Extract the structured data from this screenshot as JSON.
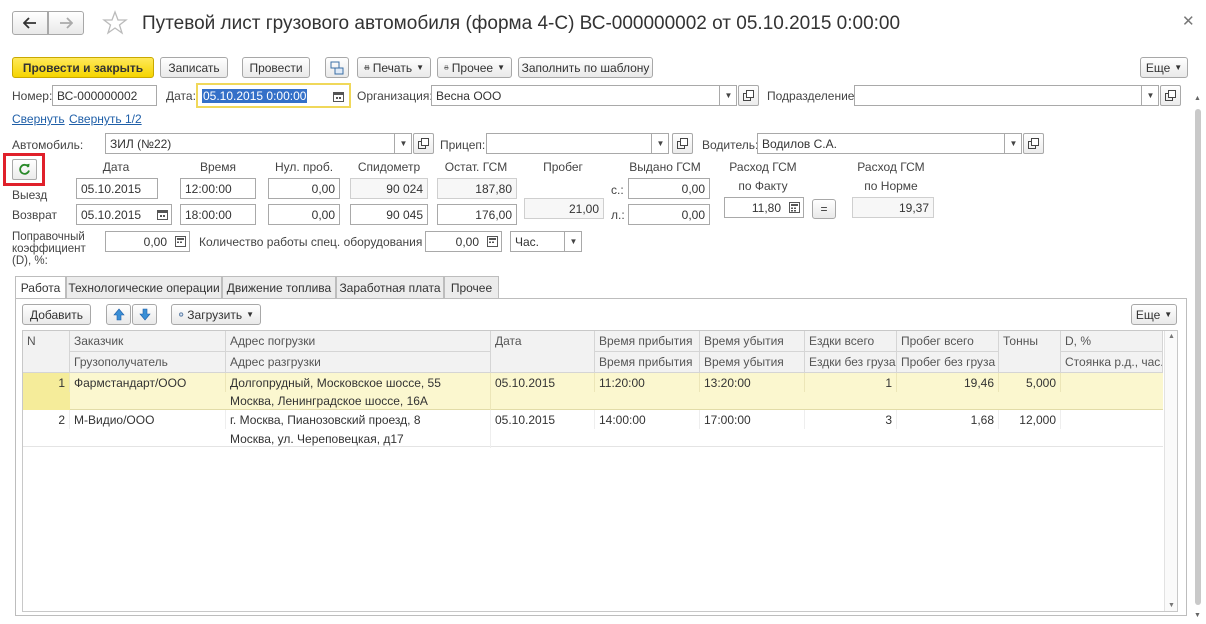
{
  "window": {
    "title": "Путевой лист грузового автомобиля (форма 4-С) ВС-000000002 от 05.10.2015 0:00:00"
  },
  "toolbar": {
    "post_close": "Провести и закрыть",
    "save": "Записать",
    "post": "Провести",
    "print": "Печать",
    "other": "Прочее",
    "fill_template": "Заполнить по шаблону",
    "more": "Еще"
  },
  "header": {
    "number_label": "Номер:",
    "number_value": "ВС-000000002",
    "date_label": "Дата:",
    "date_value": "05.10.2015  0:00:00",
    "org_label": "Организация:",
    "org_value": "Весна ООО",
    "dept_label": "Подразделение:",
    "dept_value": "",
    "collapse": "Свернуть",
    "collapse_half": "Свернуть 1/2"
  },
  "vehicle": {
    "car_label": "Автомобиль:",
    "car_value": "ЗИЛ (№22)",
    "trailer_label": "Прицеп:",
    "trailer_value": "",
    "driver_label": "Водитель:",
    "driver_value": "Водилов С.А."
  },
  "trip": {
    "col_date": "Дата",
    "col_time": "Время",
    "col_zero": "Нул. проб.",
    "col_odo": "Спидометр",
    "col_fuel": "Остат. ГСМ",
    "col_mileage": "Пробег",
    "col_issued": "Выдано ГСМ",
    "col_fact": "Расход ГСМ",
    "col_fact2": "по Факту",
    "col_norm": "Расход ГСМ",
    "col_norm2": "по Норме",
    "departure_label": "Выезд",
    "return_label": "Возврат",
    "dep_date": "05.10.2015",
    "dep_time": "12:00:00",
    "dep_zero": "0,00",
    "dep_odo": "90 024",
    "dep_fuel": "187,80",
    "ret_date": "05.10.2015",
    "ret_time": "18:00:00",
    "ret_zero": "0,00",
    "ret_odo": "90 045",
    "ret_fuel": "176,00",
    "mileage": "21,00",
    "issued_c_label": "с.:",
    "issued_c": "0,00",
    "issued_l_label": "л.:",
    "issued_l": "0,00",
    "fact": "11,80",
    "eq": "=",
    "norm": "19,37",
    "coef_label": "Поправочный коэффициент (D), %:",
    "coef_value": "0,00",
    "equip_label": "Количество работы спец. оборудования (Т):",
    "equip_value": "0,00",
    "unit_value": "Час."
  },
  "tabs": [
    "Работа",
    "Технологические операции",
    "Движение топлива",
    "Заработная плата",
    "Прочее"
  ],
  "table_toolbar": {
    "add": "Добавить",
    "load": "Загрузить",
    "more": "Еще"
  },
  "table": {
    "headers_top": [
      "N",
      "Заказчик",
      "Адрес погрузки",
      "Дата",
      "Время прибытия",
      "Время убытия",
      "Ездки всего",
      "Пробег всего",
      "Тонны",
      "D, %"
    ],
    "headers_bottom": [
      "",
      "Грузополучатель",
      "Адрес разгрузки",
      "",
      "Время прибытия",
      "Время убытия",
      "Ездки без груза",
      "Пробег без груза",
      "",
      "Стоянка р.д., час."
    ],
    "rows": [
      {
        "n": "1",
        "customer": "Фармстандарт/ООО",
        "load_addr": "Долгопрудный, Московское шоссе, 55",
        "unload_addr": "Москва, Ленинградское шоссе, 16А",
        "date": "05.10.2015",
        "arrive": "11:20:00",
        "depart": "13:20:00",
        "trips": "1",
        "mileage": "19,46",
        "tons": "5,000"
      },
      {
        "n": "2",
        "customer": "М-Видио/ООО",
        "load_addr": "г. Москва, Пианозовский проезд, 8",
        "unload_addr": "Москва, ул. Череповецкая, д17",
        "date": "05.10.2015",
        "arrive": "14:00:00",
        "depart": "17:00:00",
        "trips": "3",
        "mileage": "1,68",
        "tons": "12,000"
      }
    ]
  },
  "colors": {
    "primary_button": "#f5d400",
    "selected_row": "#fbf7cf",
    "link": "#1f5fa8",
    "highlight_frame": "#e0202a"
  }
}
